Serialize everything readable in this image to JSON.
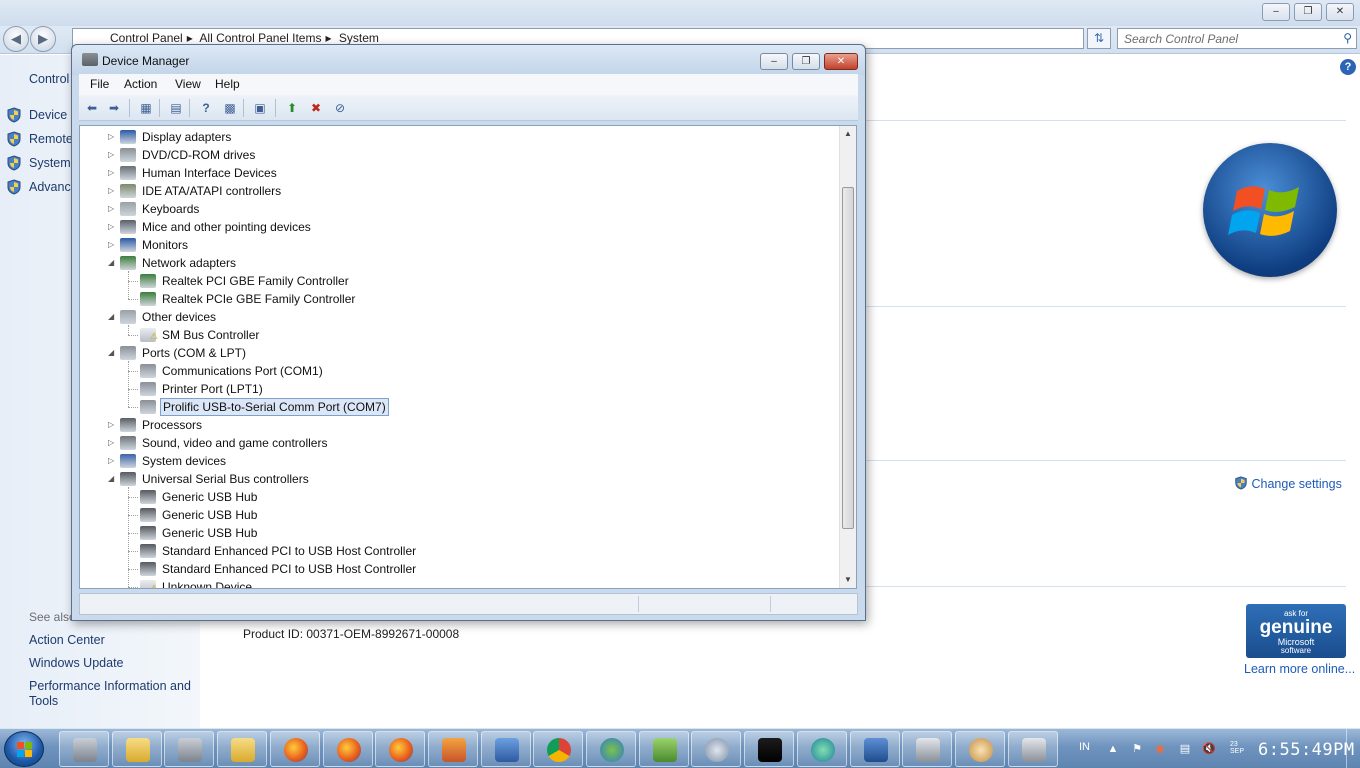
{
  "control_panel": {
    "breadcrumbs": [
      "Control Panel",
      "All Control Panel Items",
      "System"
    ],
    "search_placeholder": "Search Control Panel",
    "sidebar": {
      "header": "Control",
      "items": [
        "Device M",
        "Remote",
        "System",
        "Advanc"
      ],
      "see_also_label": "See also",
      "see_also_links": [
        "Action Center",
        "Windows Update",
        "Performance Information and Tools"
      ]
    },
    "change_settings": "Change settings",
    "product_id": "Product ID: 00371-OEM-8992671-00008",
    "genuine": {
      "line1": "ask for",
      "line2": "genuine",
      "line3": "Microsoft",
      "line4": "software"
    },
    "learn_more": "Learn more online..."
  },
  "device_manager": {
    "title": "Device Manager",
    "menu": [
      "File",
      "Action",
      "View",
      "Help"
    ],
    "tree": [
      {
        "label": "Display adapters",
        "level": 0,
        "state": "collapsed",
        "icon": "monitor-icon"
      },
      {
        "label": "DVD/CD-ROM drives",
        "level": 0,
        "state": "collapsed",
        "icon": "disc-drive-icon"
      },
      {
        "label": "Human Interface Devices",
        "level": 0,
        "state": "collapsed",
        "icon": "hid-icon"
      },
      {
        "label": "IDE ATA/ATAPI controllers",
        "level": 0,
        "state": "collapsed",
        "icon": "ide-controller-icon"
      },
      {
        "label": "Keyboards",
        "level": 0,
        "state": "collapsed",
        "icon": "keyboard-icon"
      },
      {
        "label": "Mice and other pointing devices",
        "level": 0,
        "state": "collapsed",
        "icon": "mouse-icon"
      },
      {
        "label": "Monitors",
        "level": 0,
        "state": "collapsed",
        "icon": "monitor-icon"
      },
      {
        "label": "Network adapters",
        "level": 0,
        "state": "expanded",
        "icon": "network-adapter-icon"
      },
      {
        "label": "Realtek PCI GBE Family Controller",
        "level": 1,
        "icon": "network-adapter-icon"
      },
      {
        "label": "Realtek PCIe GBE Family Controller",
        "level": 1,
        "icon": "network-adapter-icon"
      },
      {
        "label": "Other devices",
        "level": 0,
        "state": "expanded",
        "icon": "unknown-device-icon"
      },
      {
        "label": "SM Bus Controller",
        "level": 1,
        "icon": "warning-device-icon"
      },
      {
        "label": "Ports (COM & LPT)",
        "level": 0,
        "state": "expanded",
        "icon": "port-icon"
      },
      {
        "label": "Communications Port (COM1)",
        "level": 1,
        "icon": "port-icon"
      },
      {
        "label": "Printer Port (LPT1)",
        "level": 1,
        "icon": "port-icon"
      },
      {
        "label": "Prolific USB-to-Serial Comm Port (COM7)",
        "level": 1,
        "icon": "port-icon",
        "selected": true
      },
      {
        "label": "Processors",
        "level": 0,
        "state": "collapsed",
        "icon": "processor-icon"
      },
      {
        "label": "Sound, video and game controllers",
        "level": 0,
        "state": "collapsed",
        "icon": "speaker-icon"
      },
      {
        "label": "System devices",
        "level": 0,
        "state": "collapsed",
        "icon": "system-device-icon"
      },
      {
        "label": "Universal Serial Bus controllers",
        "level": 0,
        "state": "expanded",
        "icon": "usb-icon"
      },
      {
        "label": "Generic USB Hub",
        "level": 1,
        "icon": "usb-icon"
      },
      {
        "label": "Generic USB Hub",
        "level": 1,
        "icon": "usb-icon"
      },
      {
        "label": "Generic USB Hub",
        "level": 1,
        "icon": "usb-icon"
      },
      {
        "label": "Standard Enhanced PCI to USB Host Controller",
        "level": 1,
        "icon": "usb-icon"
      },
      {
        "label": "Standard Enhanced PCI to USB Host Controller",
        "level": 1,
        "icon": "usb-icon"
      },
      {
        "label": "Unknown Device",
        "level": 1,
        "icon": "warning-device-icon"
      }
    ]
  },
  "taskbar": {
    "language": "IN",
    "date_line1": "23",
    "date_line2": "SEP",
    "time": "6:55:49PM",
    "apps": [
      "device-manager-icon",
      "folder-icon",
      "device-manager-icon",
      "folder-icon",
      "firefox-icon",
      "firefox-icon",
      "firefox-icon",
      "image-editor-icon",
      "phone-sync-icon",
      "chrome-icon",
      "download-manager-icon",
      "notepad-plus-icon",
      "settings-gear-icon",
      "command-prompt-icon",
      "network-icon",
      "remote-desktop-icon",
      "printer-icon",
      "paint-icon",
      "printer-icon"
    ]
  },
  "colors": {
    "accent": "#1e5bb8",
    "selection": "#dbe7f7",
    "taskbar": "#6f94be"
  }
}
